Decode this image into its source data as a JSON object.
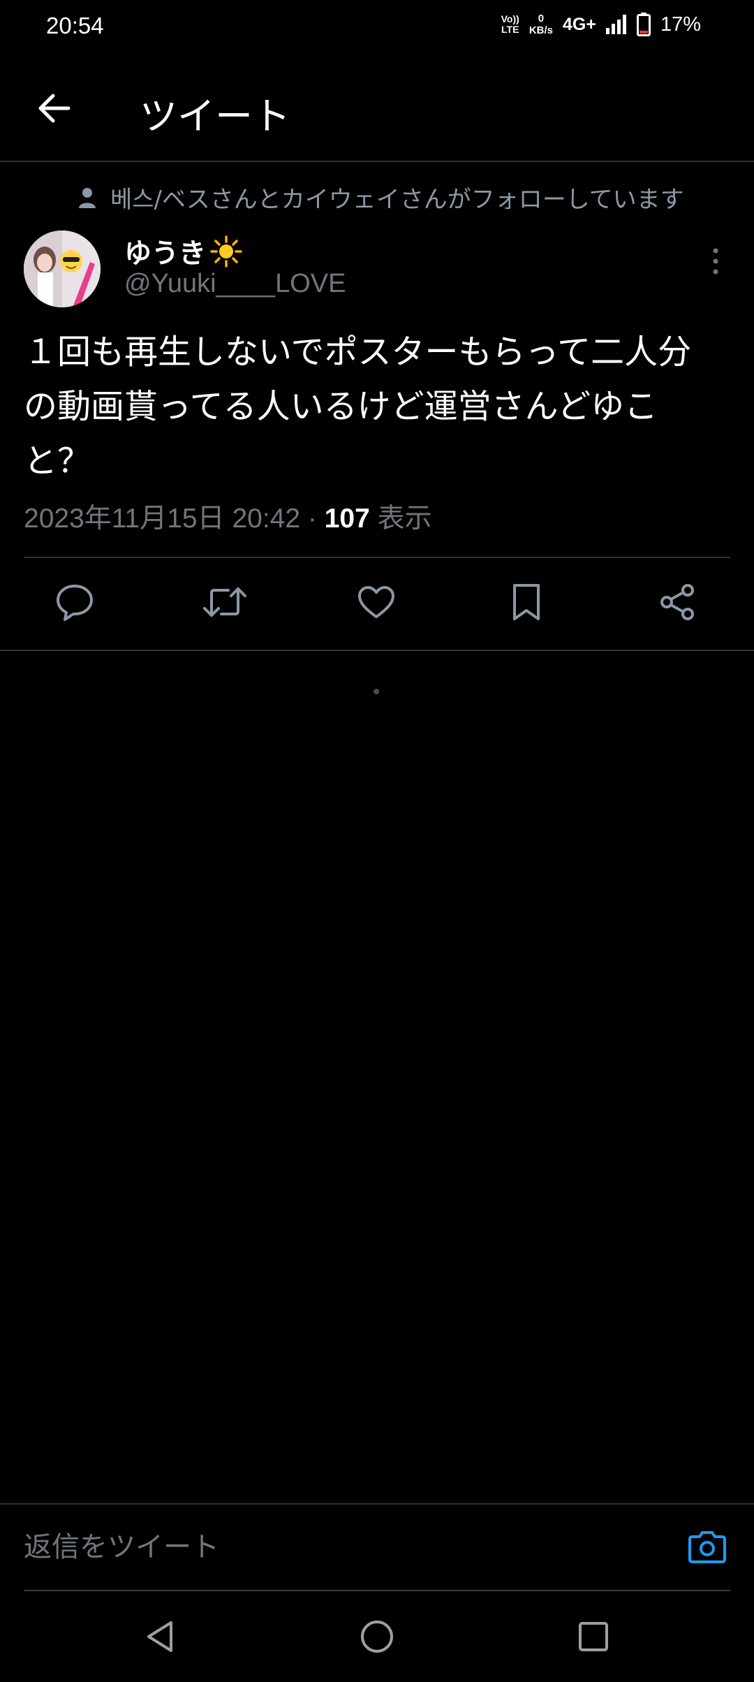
{
  "status_bar": {
    "time": "20:54",
    "volte_top": "Vo))",
    "volte_bottom": "LTE",
    "speed_value": "0",
    "speed_unit": "KB/s",
    "network": "4G+",
    "battery_percent": "17%",
    "battery_level": 0.17,
    "icons": [
      "volte-icon",
      "data-speed-indicator",
      "signal-icon",
      "battery-icon"
    ]
  },
  "header": {
    "title": "ツイート",
    "back_icon": "arrow-left-icon"
  },
  "tweet": {
    "social_context": "베스/ベスさんとカイウェイさんがフォローしています",
    "author_name": "ゆうき",
    "author_emoji": "sun-emoji",
    "author_handle": "@Yuuki____LOVE",
    "text": "１回も再生しないでポスターもらって二人分\nの動画貰ってる人いるけど運営さんどゆこ\nと？",
    "timestamp": "2023年11月15日 20:42",
    "meta_separator": " · ",
    "views_count": "107",
    "views_label": " 表示",
    "actions": [
      "reply-icon",
      "retweet-icon",
      "like-icon",
      "bookmark-icon",
      "share-icon"
    ]
  },
  "reply_bar": {
    "placeholder": "返信をツイート",
    "camera_icon": "camera-icon"
  },
  "nav_bar": {
    "icons": [
      "nav-back-icon",
      "nav-home-icon",
      "nav-recents-icon"
    ]
  },
  "colors": {
    "background": "#000000",
    "text_primary": "#e7e9ea",
    "text_secondary": "#71767b",
    "divider": "#2f3336",
    "accent": "#1d9bf0"
  }
}
